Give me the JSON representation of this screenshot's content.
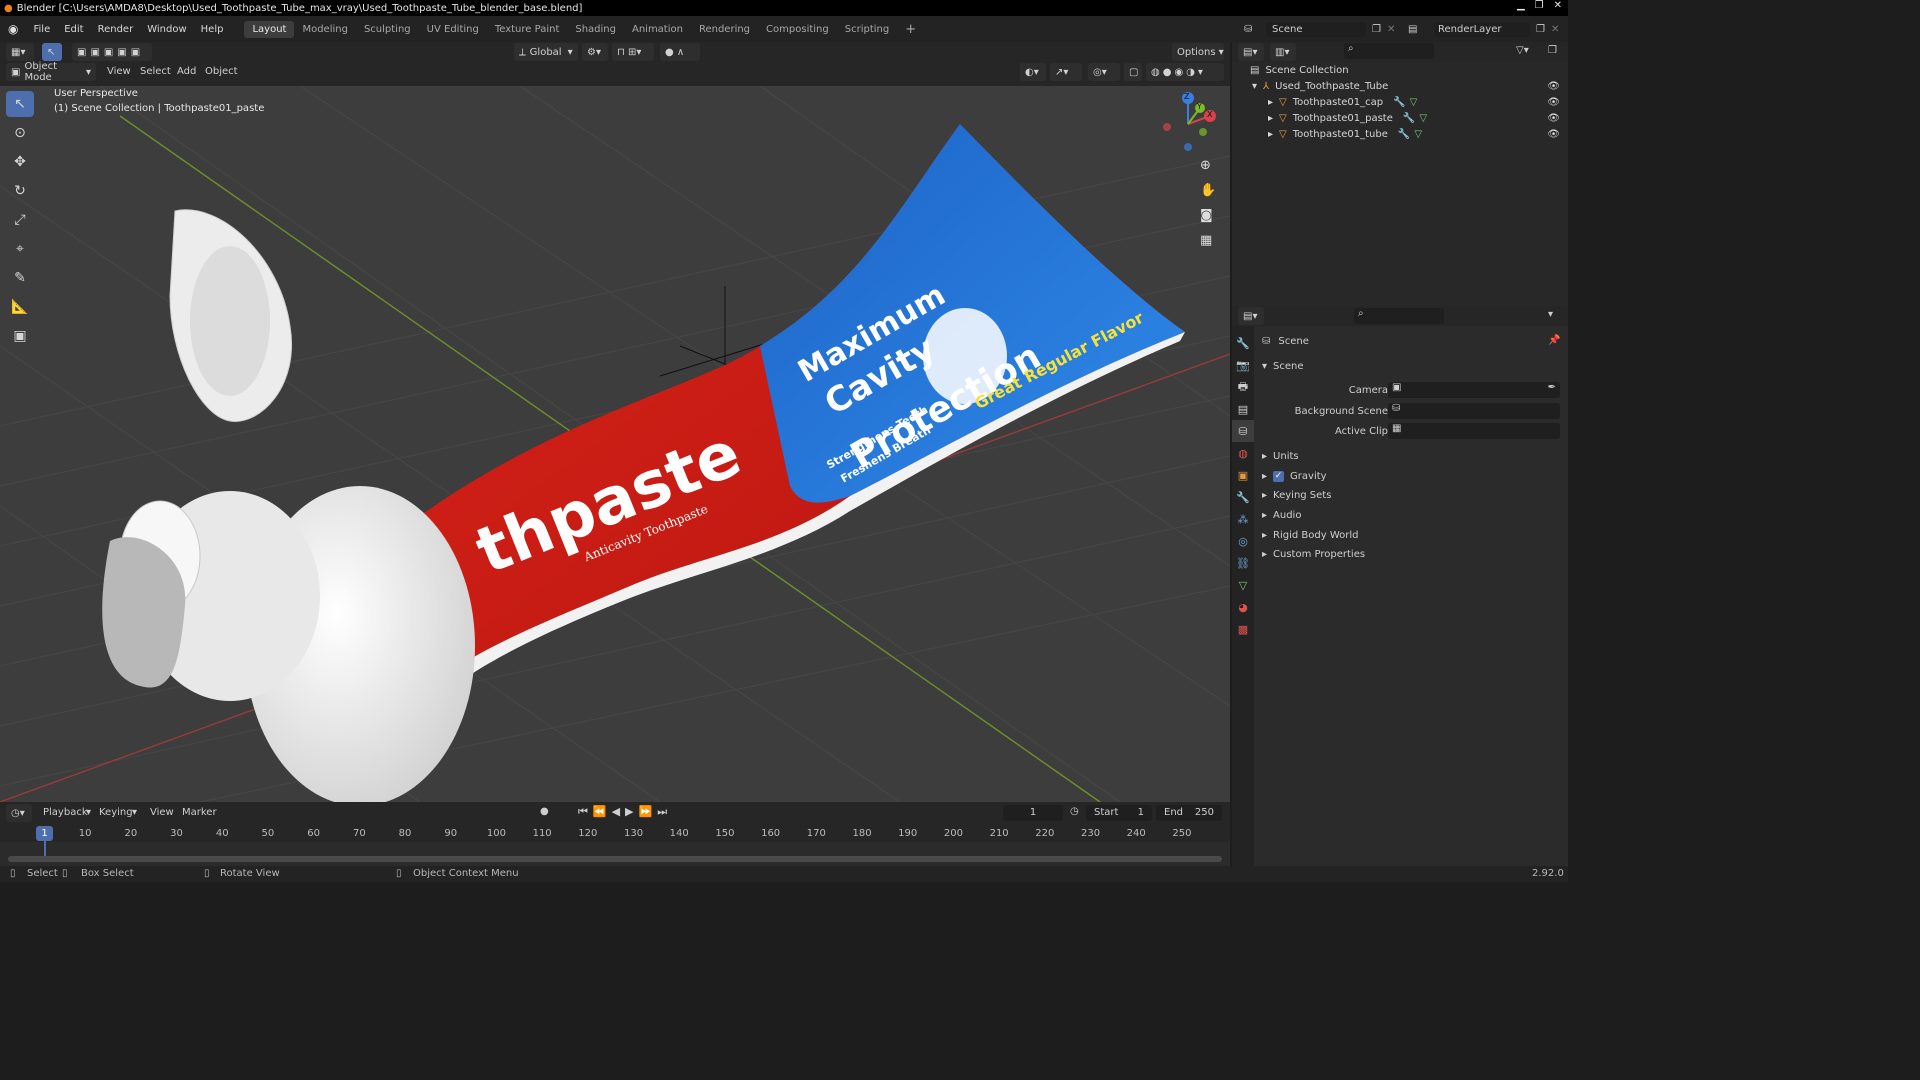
{
  "titlebar": {
    "title": "Blender [C:\\Users\\AMDA8\\Desktop\\Used_Toothpaste_Tube_max_vray\\Used_Toothpaste_Tube_blender_base.blend]"
  },
  "menu": {
    "items": [
      "File",
      "Edit",
      "Render",
      "Window",
      "Help"
    ]
  },
  "workspaces": {
    "tabs": [
      "Layout",
      "Modeling",
      "Sculpting",
      "UV Editing",
      "Texture Paint",
      "Shading",
      "Animation",
      "Rendering",
      "Compositing",
      "Scripting"
    ],
    "active": "Layout",
    "add": "+"
  },
  "scene_selector": {
    "value": "Scene"
  },
  "viewlayer_selector": {
    "value": "RenderLayer"
  },
  "viewport_header": {
    "transform_orientation": "Global",
    "options": "Options",
    "mode": "Object Mode",
    "menus": [
      "View",
      "Select",
      "Add",
      "Object"
    ]
  },
  "viewport": {
    "perspective_label": "User Perspective",
    "collection_label": "(1) Scene Collection | Toothpaste01_paste",
    "gizmo_axes": [
      "Z",
      "Y",
      "X"
    ],
    "tube_text": {
      "brand": "thpaste",
      "sub": "Anticavity Toothpaste",
      "line1": "Maximum",
      "line2": "Cavity",
      "line3": "Protection",
      "strap": "Great Regular Flavor",
      "small1": "Strengthens Teeth",
      "small2": "Freshens Breath"
    }
  },
  "outliner": {
    "root": "Scene Collection",
    "collection": "Used_Toothpaste_Tube",
    "objects": [
      "Toothpaste01_cap",
      "Toothpaste01_paste",
      "Toothpaste01_tube"
    ]
  },
  "properties": {
    "title": "Scene",
    "section": "Scene",
    "fields": [
      {
        "label": "Camera"
      },
      {
        "label": "Background Scene"
      },
      {
        "label": "Active Clip"
      }
    ],
    "panels": [
      "Units",
      "Gravity",
      "Keying Sets",
      "Audio",
      "Rigid Body World",
      "Custom Properties"
    ],
    "gravity_checked": true
  },
  "timeline": {
    "menus": [
      "Playback",
      "Keying",
      "View",
      "Marker"
    ],
    "current_frame": "1",
    "start_label": "Start",
    "start": "1",
    "end_label": "End",
    "end": "250",
    "ticks": [
      "10",
      "20",
      "30",
      "40",
      "50",
      "60",
      "70",
      "80",
      "90",
      "100",
      "110",
      "120",
      "130",
      "140",
      "150",
      "160",
      "170",
      "180",
      "190",
      "200",
      "210",
      "220",
      "230",
      "240",
      "250"
    ],
    "playhead": "1"
  },
  "statusbar": {
    "select": "Select",
    "box_select": "Box Select",
    "rotate": "Rotate View",
    "context": "Object Context Menu",
    "version": "2.92.0"
  },
  "colors": {
    "accent": "#4e6fae",
    "selected_tab": "#3d3d3d",
    "viewport_bg": "#3d3d3d"
  }
}
